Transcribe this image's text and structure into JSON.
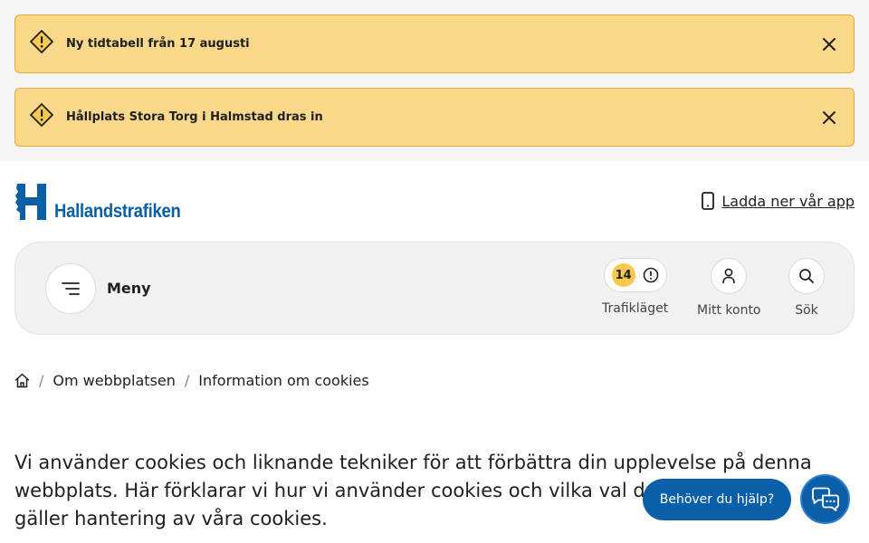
{
  "alerts": [
    {
      "text": "Ny tidtabell från 17 augusti",
      "icon": "warning-icon",
      "close_icon": "close-icon"
    },
    {
      "text": "Hållplats Stora Torg i Halmstad dras in",
      "icon": "warning-icon",
      "close_icon": "close-icon"
    }
  ],
  "header": {
    "logo_text": "Hallandstrafiken",
    "app_link": "Ladda ner vår app"
  },
  "nav": {
    "menu_label": "Meny",
    "traffic": {
      "count": "14",
      "label": "Trafikläget"
    },
    "account": {
      "label": "Mitt konto"
    },
    "search": {
      "label": "Sök"
    }
  },
  "breadcrumb": [
    "Om webbplatsen",
    "Information om cookies"
  ],
  "intro": "Vi använder cookies och liknande tekniker för att förbättra din upplevelse på denna webbplats. Här förklarar vi hur vi använder cookies och vilka val du har när det gäller hantering av våra cookies.",
  "help": {
    "label": "Behöver du hjälp?"
  },
  "colors": {
    "brand_blue": "#0a5fa8",
    "alert_bg": "#fcd98a",
    "alert_border": "#e8a93a",
    "badge": "#f8c94a"
  }
}
